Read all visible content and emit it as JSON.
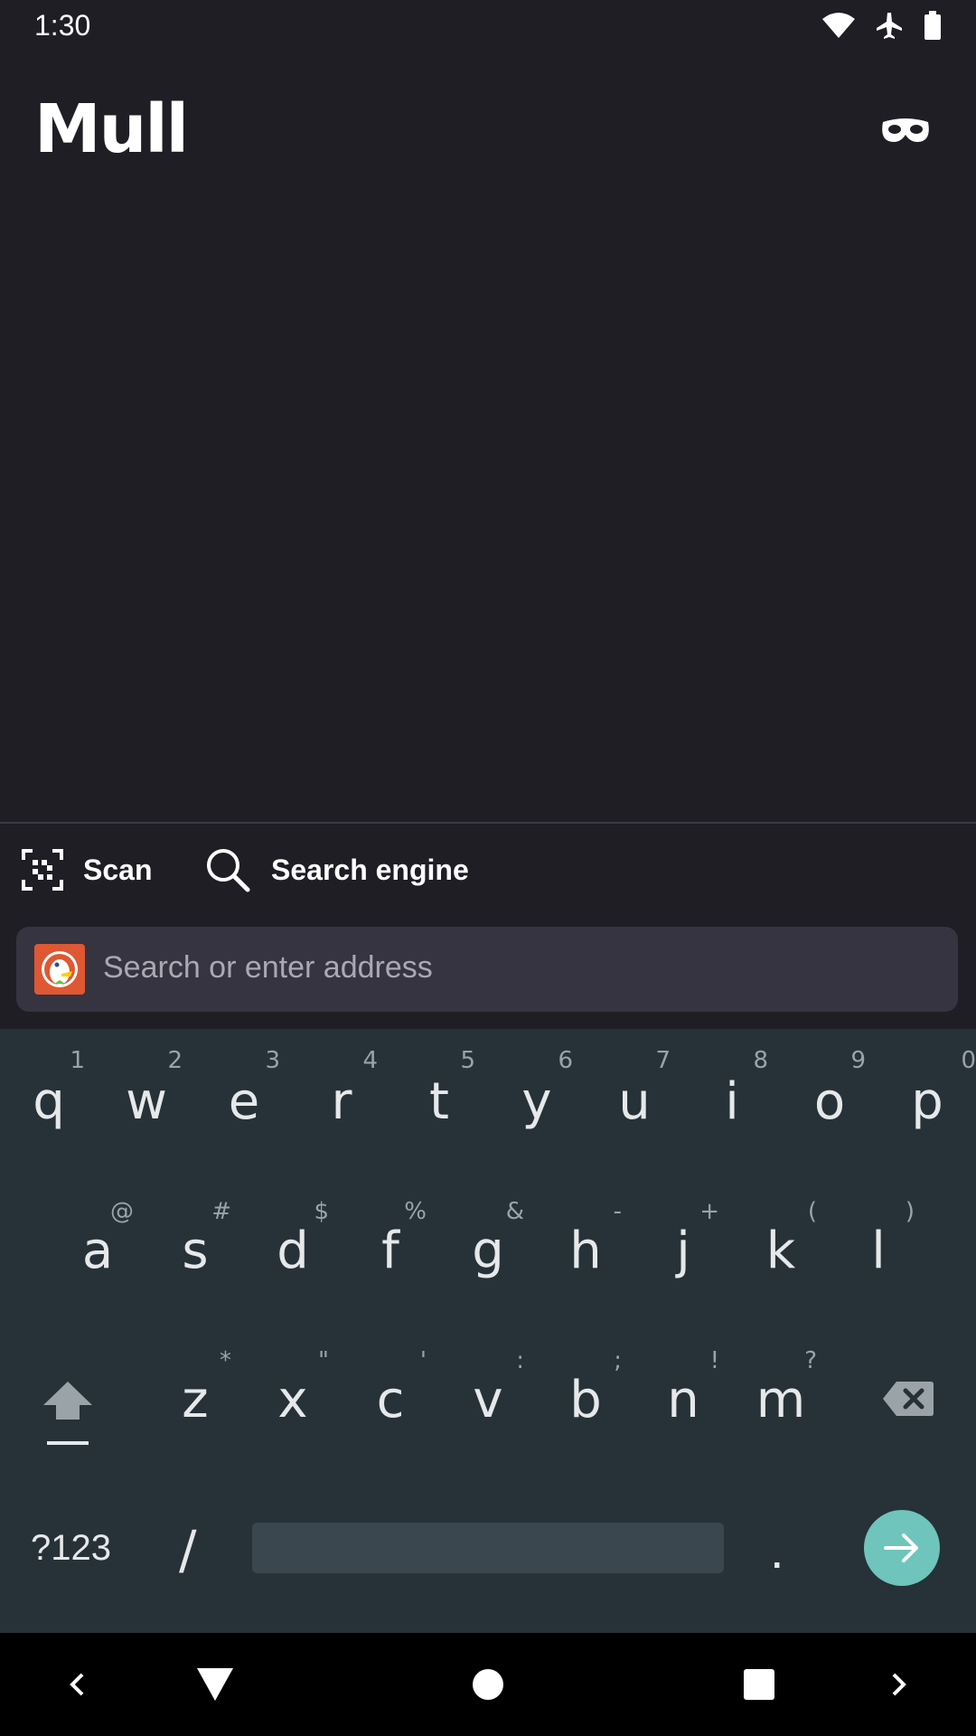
{
  "status_bar": {
    "time": "1:30",
    "icons": [
      "wifi-icon",
      "airplane-icon",
      "battery-icon"
    ]
  },
  "header": {
    "title": "Mull",
    "private_mode_icon": "mask-icon"
  },
  "toolbar": {
    "scan_label": "Scan",
    "search_engine_label": "Search engine"
  },
  "url_bar": {
    "placeholder": "Search or enter address",
    "engine_icon": "duckduckgo-icon"
  },
  "keyboard": {
    "row1": [
      {
        "key": "q",
        "hint": "1"
      },
      {
        "key": "w",
        "hint": "2"
      },
      {
        "key": "e",
        "hint": "3"
      },
      {
        "key": "r",
        "hint": "4"
      },
      {
        "key": "t",
        "hint": "5"
      },
      {
        "key": "y",
        "hint": "6"
      },
      {
        "key": "u",
        "hint": "7"
      },
      {
        "key": "i",
        "hint": "8"
      },
      {
        "key": "o",
        "hint": "9"
      },
      {
        "key": "p",
        "hint": "0"
      }
    ],
    "row2": [
      {
        "key": "a",
        "hint": "@"
      },
      {
        "key": "s",
        "hint": "#"
      },
      {
        "key": "d",
        "hint": "$"
      },
      {
        "key": "f",
        "hint": "%"
      },
      {
        "key": "g",
        "hint": "&"
      },
      {
        "key": "h",
        "hint": "-"
      },
      {
        "key": "j",
        "hint": "+"
      },
      {
        "key": "k",
        "hint": "("
      },
      {
        "key": "l",
        "hint": ")"
      }
    ],
    "row3": [
      {
        "key": "z",
        "hint": "*"
      },
      {
        "key": "x",
        "hint": "\""
      },
      {
        "key": "c",
        "hint": "'"
      },
      {
        "key": "v",
        "hint": ":"
      },
      {
        "key": "b",
        "hint": ";"
      },
      {
        "key": "n",
        "hint": "!"
      },
      {
        "key": "m",
        "hint": "?"
      }
    ],
    "symbols_label": "?123",
    "slash_label": "/",
    "period_label": ".",
    "enter_color": "#6fc4bb"
  },
  "colors": {
    "background": "#1f1e25",
    "url_bar": "#353440",
    "keyboard": "#263238"
  }
}
